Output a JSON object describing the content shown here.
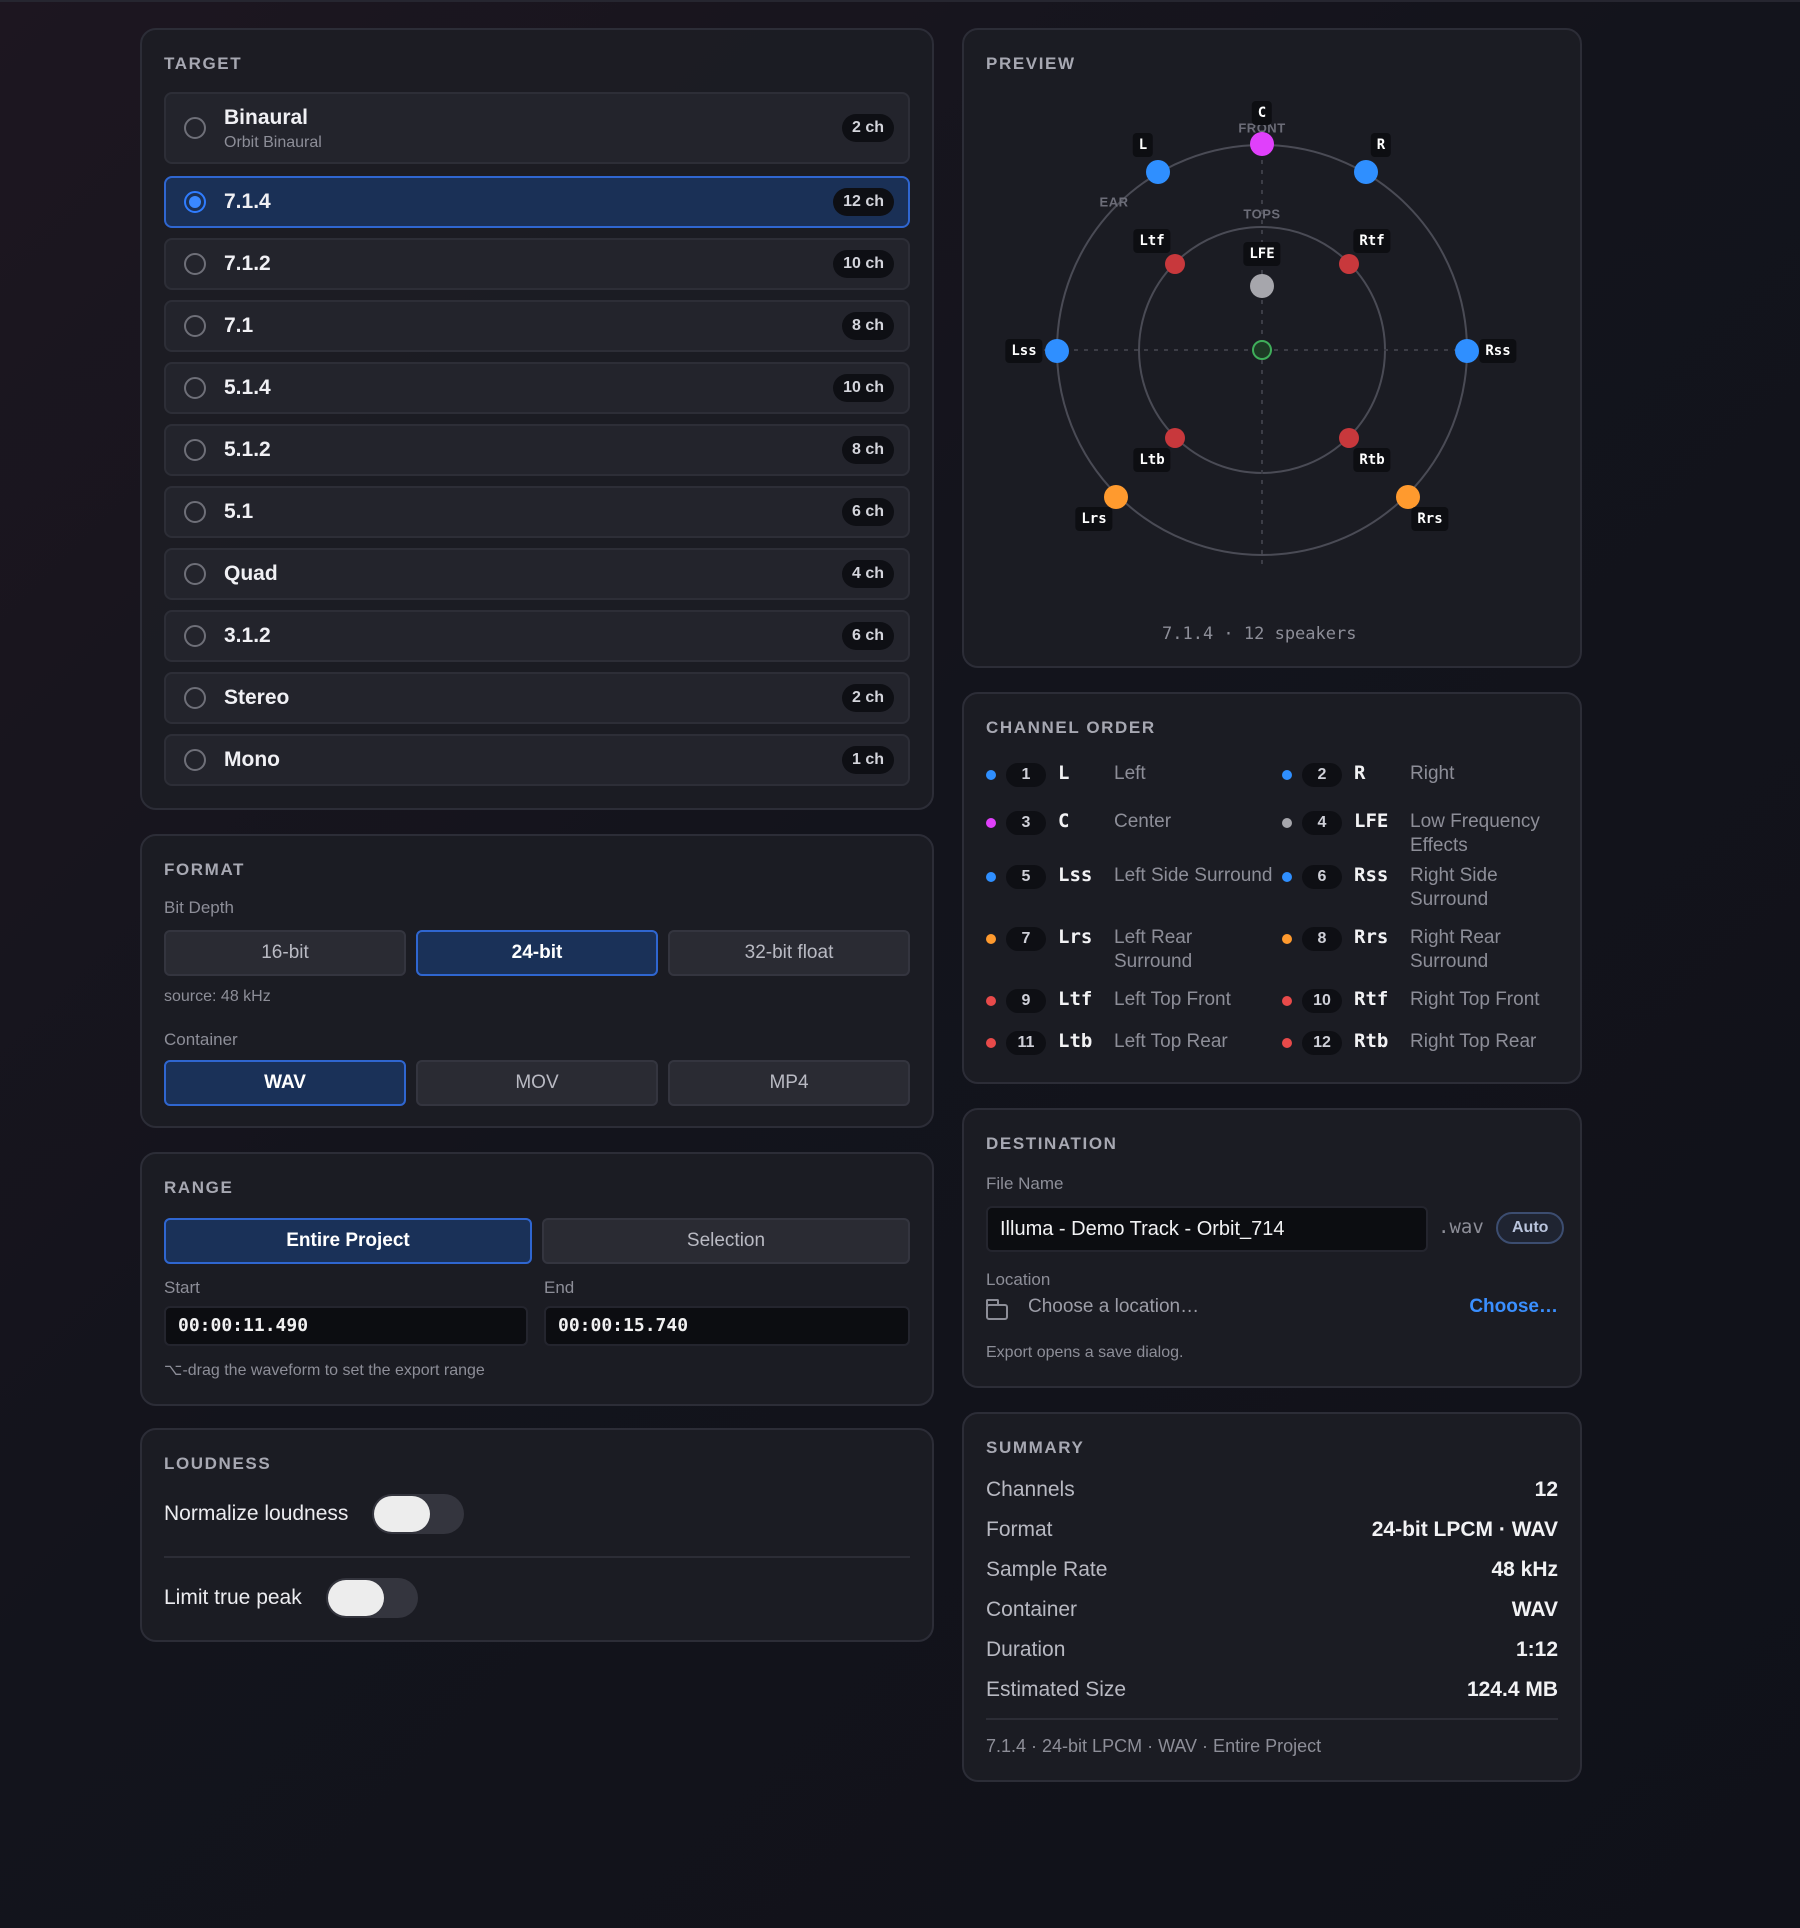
{
  "target": {
    "title": "TARGET",
    "items": [
      {
        "name": "Binaural",
        "sub": "Orbit Binaural",
        "channels": "2 ch",
        "selected": false
      },
      {
        "name": "7.1.4",
        "channels": "12 ch",
        "selected": true
      },
      {
        "name": "7.1.2",
        "channels": "10 ch",
        "selected": false
      },
      {
        "name": "7.1",
        "channels": "8 ch",
        "selected": false
      },
      {
        "name": "5.1.4",
        "channels": "10 ch",
        "selected": false
      },
      {
        "name": "5.1.2",
        "channels": "8 ch",
        "selected": false
      },
      {
        "name": "5.1",
        "channels": "6 ch",
        "selected": false
      },
      {
        "name": "Quad",
        "channels": "4 ch",
        "selected": false
      },
      {
        "name": "3.1.2",
        "channels": "6 ch",
        "selected": false
      },
      {
        "name": "Stereo",
        "channels": "2 ch",
        "selected": false
      },
      {
        "name": "Mono",
        "channels": "1 ch",
        "selected": false
      }
    ]
  },
  "format": {
    "title": "FORMAT",
    "bit_depth_label": "Bit Depth",
    "bit_depths": [
      "16-bit",
      "24-bit",
      "32-bit float"
    ],
    "bit_depth_selected": "24-bit",
    "source_note": "source: 48 kHz",
    "container_label": "Container",
    "containers": [
      "WAV",
      "MOV",
      "MP4"
    ],
    "container_selected": "WAV"
  },
  "range": {
    "title": "RANGE",
    "options": [
      "Entire Project",
      "Selection"
    ],
    "selected": "Entire Project",
    "start_label": "Start",
    "start_value": "00:00:11.490",
    "end_label": "End",
    "end_value": "00:00:15.740",
    "hint": "⌥-drag the waveform to set the export range"
  },
  "loudness": {
    "title": "LOUDNESS",
    "normalize_label": "Normalize loudness",
    "normalize_on": false,
    "limit_label": "Limit true peak",
    "limit_on": false
  },
  "preview": {
    "title": "PREVIEW",
    "zone_labels": {
      "front": "FRONT",
      "ear": "EAR",
      "tops": "TOPS"
    },
    "speaker_labels": [
      "C",
      "L",
      "R",
      "Ltf",
      "Rtf",
      "LFE",
      "Lss",
      "Rss",
      "Ltb",
      "Rtb",
      "Lrs",
      "Rrs"
    ],
    "caption": "7.1.4 · 12 speakers"
  },
  "channel_order": {
    "title": "CHANNEL ORDER",
    "channels": [
      {
        "num": "1",
        "abbr": "L",
        "name": "Left",
        "color": "#2f8fff"
      },
      {
        "num": "2",
        "abbr": "R",
        "name": "Right",
        "color": "#2f8fff"
      },
      {
        "num": "3",
        "abbr": "C",
        "name": "Center",
        "color": "#e040fb"
      },
      {
        "num": "4",
        "abbr": "LFE",
        "name": "Low Frequency Effects",
        "color": "#a6a6ac"
      },
      {
        "num": "5",
        "abbr": "Lss",
        "name": "Left Side Surround",
        "color": "#2f8fff"
      },
      {
        "num": "6",
        "abbr": "Rss",
        "name": "Right Side Surround",
        "color": "#2f8fff"
      },
      {
        "num": "7",
        "abbr": "Lrs",
        "name": "Left Rear Surround",
        "color": "#ff9a2e"
      },
      {
        "num": "8",
        "abbr": "Rrs",
        "name": "Right Rear Surround",
        "color": "#ff9a2e"
      },
      {
        "num": "9",
        "abbr": "Ltf",
        "name": "Left Top Front",
        "color": "#e84a4a"
      },
      {
        "num": "10",
        "abbr": "Rtf",
        "name": "Right Top Front",
        "color": "#e84a4a"
      },
      {
        "num": "11",
        "abbr": "Ltb",
        "name": "Left Top Rear",
        "color": "#e84a4a"
      },
      {
        "num": "12",
        "abbr": "Rtb",
        "name": "Right Top Rear",
        "color": "#e84a4a"
      }
    ]
  },
  "destination": {
    "title": "DESTINATION",
    "file_name_label": "File Name",
    "file_name": "Illuma - Demo Track - Orbit_714",
    "extension": ".wav",
    "auto_label": "Auto",
    "location_label": "Location",
    "location_placeholder": "Choose a location…",
    "choose_label": "Choose…",
    "note": "Export opens a save dialog."
  },
  "summary": {
    "title": "SUMMARY",
    "rows": [
      {
        "key": "Channels",
        "value": "12"
      },
      {
        "key": "Format",
        "value": "24-bit LPCM · WAV"
      },
      {
        "key": "Sample Rate",
        "value": "48 kHz"
      },
      {
        "key": "Container",
        "value": "WAV"
      },
      {
        "key": "Duration",
        "value": "1:12"
      },
      {
        "key": "Estimated Size",
        "value": "124.4 MB"
      }
    ],
    "footer": "7.1.4 · 24-bit LPCM · WAV · Entire Project"
  },
  "colors": {
    "accent": "#2f7cff",
    "side": "#2f8fff",
    "center": "#e040fb",
    "lfe": "#a6a6ac",
    "rear": "#ff9a2e",
    "top": "#c8383c",
    "listener": "#3fae5a"
  }
}
